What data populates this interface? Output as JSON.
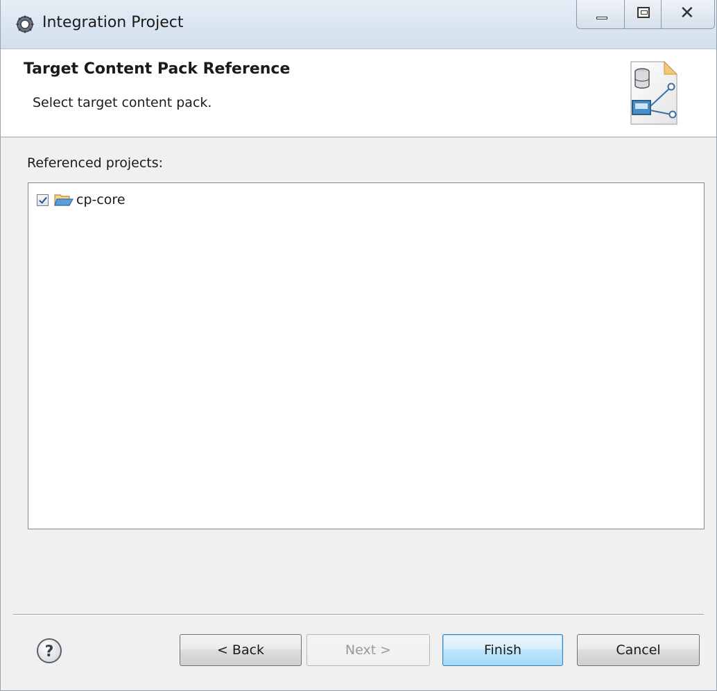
{
  "window": {
    "title": "Integration Project"
  },
  "header": {
    "title": "Target Content Pack Reference",
    "description": "Select target content pack."
  },
  "body": {
    "referenced_label": "Referenced projects:",
    "projects": [
      {
        "name": "cp-core",
        "checked": true
      }
    ]
  },
  "buttons": {
    "back": "< Back",
    "next": "Next >",
    "finish": "Finish",
    "cancel": "Cancel"
  },
  "icons": {
    "app": "eclipse-gear-icon",
    "project": "open-folder-icon",
    "header": "content-pack-wizard-icon",
    "help": "help-icon"
  },
  "colors": {
    "titlebar": "#dce7f2",
    "finish_accent": "#3c7fb1"
  }
}
